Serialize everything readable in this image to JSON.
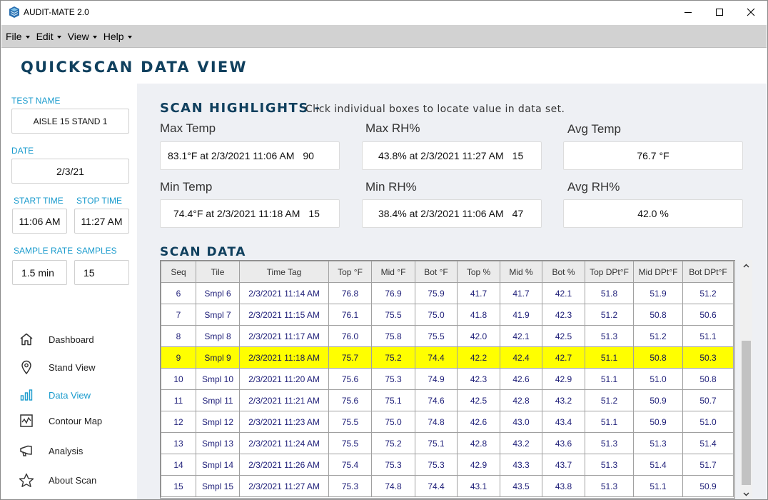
{
  "window": {
    "title": "AUDIT-MATE 2.0",
    "controls": {
      "minimize": "minimize-icon",
      "maximize": "maximize-icon",
      "close": "close-icon"
    }
  },
  "menu": [
    {
      "label": "File"
    },
    {
      "label": "Edit"
    },
    {
      "label": "View"
    },
    {
      "label": "Help"
    }
  ],
  "header": {
    "title": "QUICKSCAN DATA VIEW"
  },
  "sidebar": {
    "test_name_label": "TEST NAME",
    "test_name_value": "AISLE 15 STAND 1",
    "date_label": "DATE",
    "date_value": "2/3/21",
    "start_time_label": "START TIME",
    "start_time_value": "11:06 AM",
    "stop_time_label": "STOP TIME",
    "stop_time_value": "11:27 AM",
    "sample_rate_label": "SAMPLE RATE",
    "sample_rate_value": "1.5 min",
    "samples_label": "SAMPLES",
    "samples_value": "15",
    "nav": [
      {
        "label": "Dashboard",
        "icon": "home-icon",
        "active": false
      },
      {
        "label": "Stand View",
        "icon": "map-pin-icon",
        "active": false
      },
      {
        "label": "Data View",
        "icon": "bar-chart-icon",
        "active": true
      },
      {
        "label": "Contour Map",
        "icon": "line-chart-icon",
        "active": false
      },
      {
        "label": "Analysis",
        "icon": "megaphone-icon",
        "active": false
      },
      {
        "label": "About Scan",
        "icon": "star-icon",
        "active": false
      }
    ]
  },
  "highlights": {
    "title": "SCAN HIGHLIGHTS -",
    "subtitle": "Click individual boxes to locate value in data set.",
    "max_temp": {
      "label": "Max Temp",
      "value": "83.1°F at 2/3/2021 11:06 AM",
      "seq": "90"
    },
    "max_rh": {
      "label": "Max RH%",
      "value": "43.8% at 2/3/2021 11:27 AM",
      "seq": "15"
    },
    "avg_temp": {
      "label": "Avg Temp",
      "value": "76.7 °F"
    },
    "min_temp": {
      "label": "Min Temp",
      "value": "74.4°F at 2/3/2021 11:18 AM",
      "seq": "15"
    },
    "min_rh": {
      "label": "Min RH%",
      "value": "38.4% at 2/3/2021 11:06 AM",
      "seq": "47"
    },
    "avg_rh": {
      "label": "Avg RH%",
      "value": "42.0 %"
    }
  },
  "scan_data": {
    "title": "SCAN DATA",
    "columns": [
      "Seq",
      "Tile",
      "Time Tag",
      "Top °F",
      "Mid °F",
      "Bot °F",
      "Top %",
      "Mid %",
      "Bot %",
      "Top DPt°F",
      "Mid DPt°F",
      "Bot DPt°F"
    ],
    "highlighted_seq": "9",
    "rows": [
      [
        "6",
        "Smpl 6",
        "2/3/2021 11:14 AM",
        "76.8",
        "76.9",
        "75.9",
        "41.7",
        "41.7",
        "42.1",
        "51.8",
        "51.9",
        "51.2"
      ],
      [
        "7",
        "Smpl 7",
        "2/3/2021 11:15 AM",
        "76.1",
        "75.5",
        "75.0",
        "41.8",
        "41.9",
        "42.3",
        "51.2",
        "50.8",
        "50.6"
      ],
      [
        "8",
        "Smpl 8",
        "2/3/2021 11:17 AM",
        "76.0",
        "75.8",
        "75.5",
        "42.0",
        "42.1",
        "42.5",
        "51.3",
        "51.2",
        "51.1"
      ],
      [
        "9",
        "Smpl 9",
        "2/3/2021 11:18 AM",
        "75.7",
        "75.2",
        "74.4",
        "42.2",
        "42.4",
        "42.7",
        "51.1",
        "50.8",
        "50.3"
      ],
      [
        "10",
        "Smpl 10",
        "2/3/2021 11:20 AM",
        "75.6",
        "75.3",
        "74.9",
        "42.3",
        "42.6",
        "42.9",
        "51.1",
        "51.0",
        "50.8"
      ],
      [
        "11",
        "Smpl 11",
        "2/3/2021 11:21 AM",
        "75.6",
        "75.1",
        "74.6",
        "42.5",
        "42.8",
        "43.2",
        "51.2",
        "50.9",
        "50.7"
      ],
      [
        "12",
        "Smpl 12",
        "2/3/2021 11:23 AM",
        "75.5",
        "75.0",
        "74.8",
        "42.6",
        "43.0",
        "43.4",
        "51.1",
        "50.9",
        "51.0"
      ],
      [
        "13",
        "Smpl 13",
        "2/3/2021 11:24 AM",
        "75.5",
        "75.2",
        "75.1",
        "42.8",
        "43.2",
        "43.6",
        "51.3",
        "51.3",
        "51.4"
      ],
      [
        "14",
        "Smpl 14",
        "2/3/2021 11:26 AM",
        "75.4",
        "75.3",
        "75.3",
        "42.9",
        "43.3",
        "43.7",
        "51.3",
        "51.4",
        "51.7"
      ],
      [
        "15",
        "Smpl 15",
        "2/3/2021 11:27 AM",
        "75.3",
        "74.8",
        "74.4",
        "43.1",
        "43.5",
        "43.8",
        "51.3",
        "51.1",
        "50.9"
      ]
    ]
  },
  "colors": {
    "accent": "#1a9bcd",
    "title_navy": "#10405e",
    "row_highlight": "#ffff00",
    "main_bg": "#eef0f4",
    "menubar_bg": "#d2d2d2"
  }
}
